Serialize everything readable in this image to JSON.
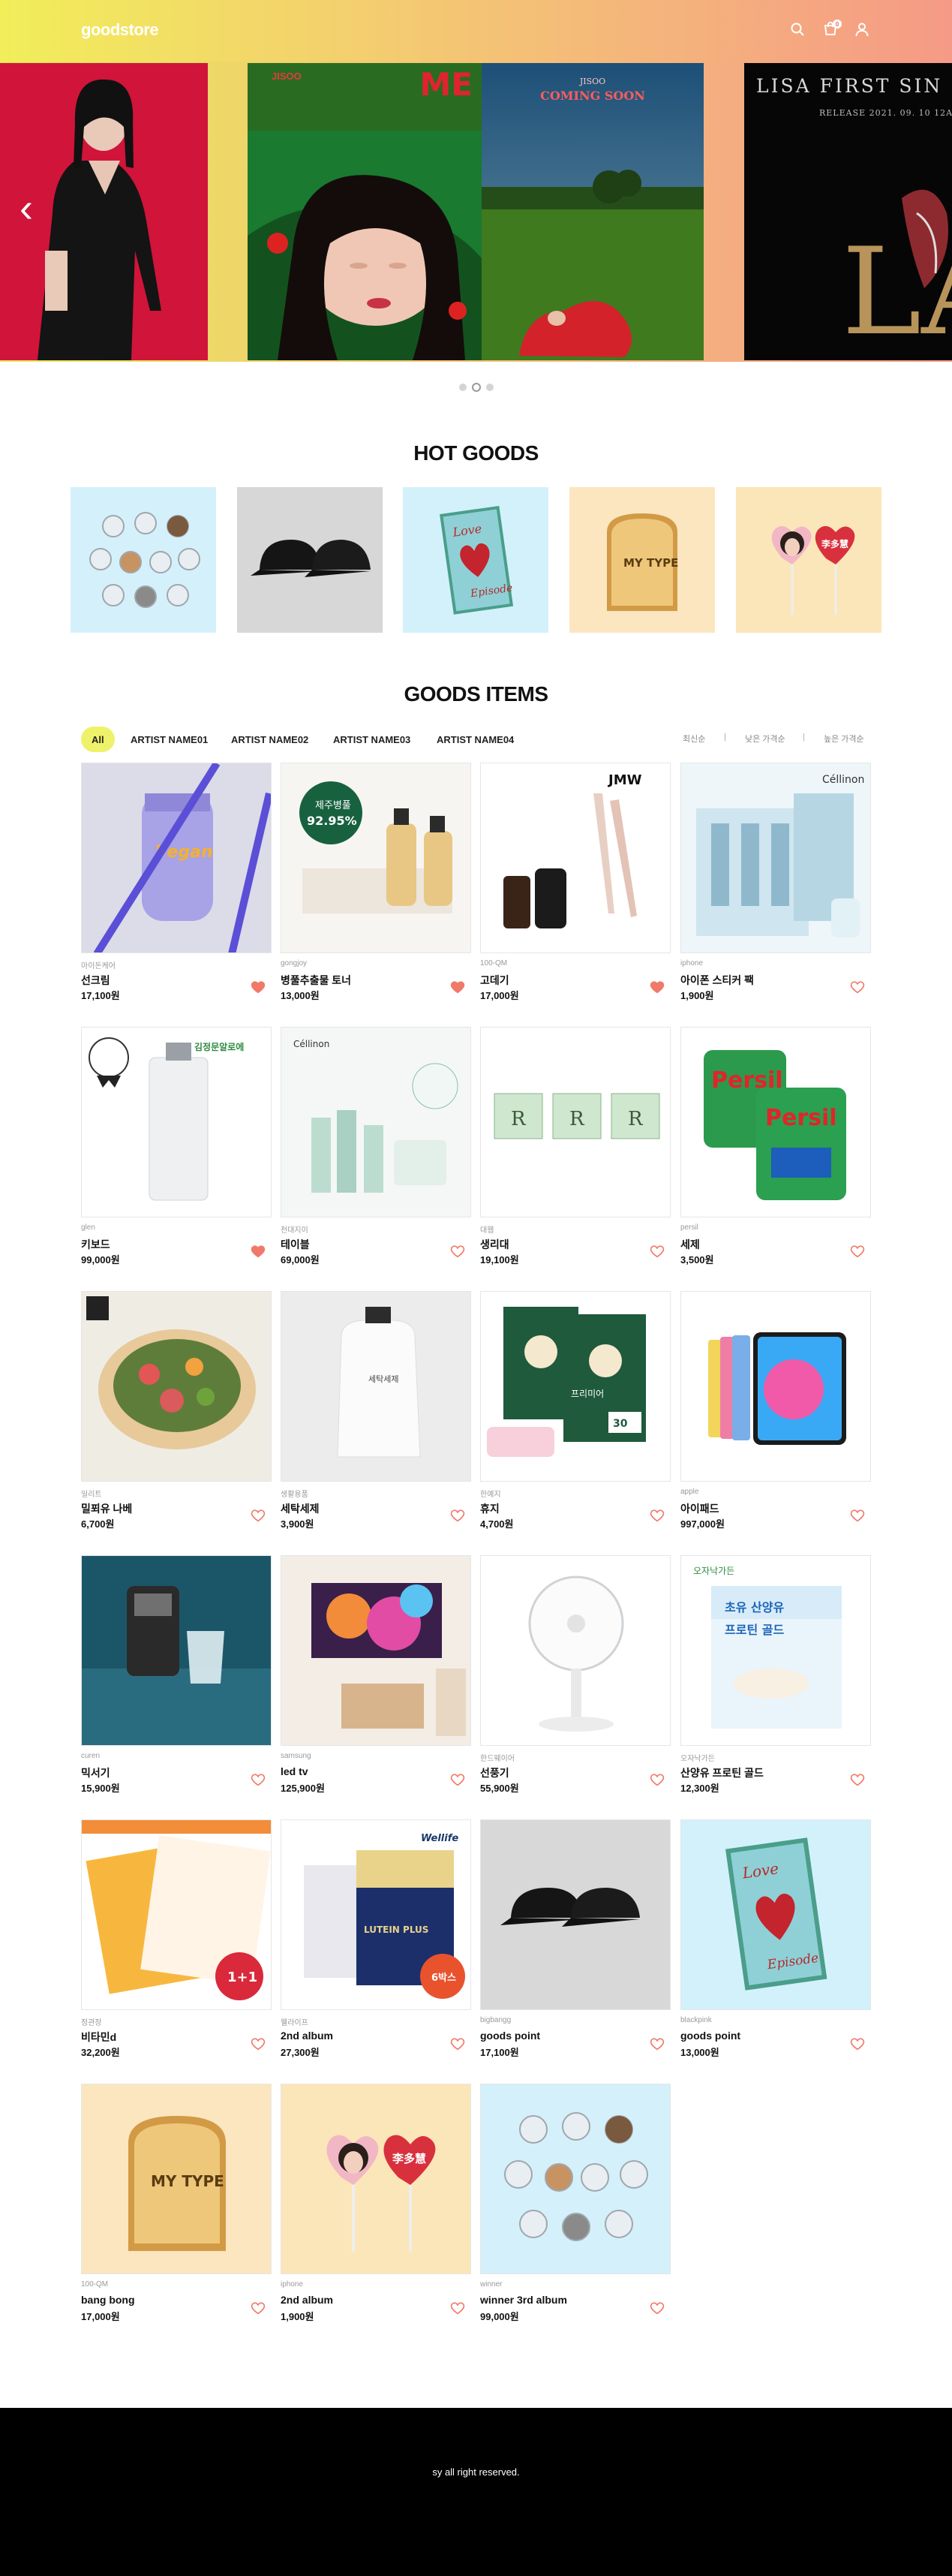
{
  "header": {
    "logo": "goodstore",
    "cart_count": "0"
  },
  "hero": {
    "slides": [
      {
        "label": ""
      },
      {
        "title": "JISOO",
        "subtitle": "ME"
      },
      {
        "title": "JISOO",
        "subtitle": "COMING SOON"
      },
      {
        "title": "LISA FIRST SIN",
        "subtitle": "RELEASE 2021. 09. 10 12A"
      }
    ],
    "active_dot": 1,
    "dot_count": 3
  },
  "hot_goods": {
    "title": "HOT GOODS"
  },
  "goods_items": {
    "title": "GOODS ITEMS",
    "filters": [
      "All",
      "ARTIST NAME01",
      "ARTIST NAME02",
      "ARTIST NAME03",
      "ARTIST NAME04"
    ],
    "sorts": [
      "최신순",
      "낮은 가격순",
      "높은 가격순"
    ],
    "products": [
      {
        "brand": "아이돈케어",
        "name": "선크림",
        "price": "17,100원",
        "liked": true,
        "img": "sunstick"
      },
      {
        "brand": "gongjoy",
        "name": "병풀추출물 토너",
        "price": "13,000원",
        "liked": true,
        "img": "toner",
        "badge": "제주병풀",
        "badge2": "92.95%"
      },
      {
        "brand": "100-QM",
        "name": "고데기",
        "price": "17,000원",
        "liked": true,
        "img": "iron",
        "tag": "JMW"
      },
      {
        "brand": "iphone",
        "name": "아이폰 스티커 팩",
        "price": "1,900원",
        "liked": false,
        "img": "cellinon",
        "tag": "Céllinon"
      },
      {
        "brand": "glen",
        "name": "키보드",
        "price": "99,000원",
        "liked": true,
        "img": "bottle"
      },
      {
        "brand": "천대지이",
        "name": "테이블",
        "price": "69,000원",
        "liked": false,
        "img": "cellinon2",
        "tag": "Céllinon"
      },
      {
        "brand": "대웹",
        "name": "생리대",
        "price": "19,100원",
        "liked": false,
        "img": "pads"
      },
      {
        "brand": "persil",
        "name": "세제",
        "price": "3,500원",
        "liked": false,
        "img": "persil",
        "tag": "Persil"
      },
      {
        "brand": "일리트",
        "name": "밀푀유 나베",
        "price": "6,700원",
        "liked": false,
        "img": "nabe"
      },
      {
        "brand": "생활용품",
        "name": "세탁세제",
        "price": "3,900원",
        "liked": false,
        "img": "detergent"
      },
      {
        "brand": "한예지",
        "name": "휴지",
        "price": "4,700원",
        "liked": false,
        "img": "tissue"
      },
      {
        "brand": "apple",
        "name": "아이패드",
        "price": "997,000원",
        "liked": false,
        "img": "ipad"
      },
      {
        "brand": "curen",
        "name": "믹서기",
        "price": "15,900원",
        "liked": false,
        "img": "blender"
      },
      {
        "brand": "samsung",
        "name": "led tv",
        "price": "125,900원",
        "liked": false,
        "img": "tv"
      },
      {
        "brand": "한드웨이어",
        "name": "선풍기",
        "price": "55,900원",
        "liked": false,
        "img": "fan"
      },
      {
        "brand": "오자낙가든",
        "name": "산양유 프로틴 골드",
        "price": "12,300원",
        "liked": false,
        "img": "protein",
        "tag": "초유 산양유 프로틴 골드"
      },
      {
        "brand": "정관장",
        "name": "비타민d",
        "price": "32,200원",
        "liked": false,
        "img": "vitamin",
        "tag": "1+1"
      },
      {
        "brand": "웰라이프",
        "name": "2nd album",
        "price": "27,300원",
        "liked": false,
        "img": "lutein",
        "tag": "LUTEIN PLUS"
      },
      {
        "brand": "bigbangg",
        "name": "goods point",
        "price": "17,100원",
        "liked": false,
        "img": "caps"
      },
      {
        "brand": "blackpink",
        "name": "goods point",
        "price": "13,000원",
        "liked": false,
        "img": "episode"
      },
      {
        "brand": "100-QM",
        "name": "bang bong",
        "price": "17,000원",
        "liked": false,
        "img": "mytype",
        "tag": "MY TYPE"
      },
      {
        "brand": "iphone",
        "name": "2nd album",
        "price": "1,900원",
        "liked": false,
        "img": "fans"
      },
      {
        "brand": "winner",
        "name": "winner 3rd album",
        "price": "99,000원",
        "liked": false,
        "img": "pins"
      }
    ]
  },
  "footer": {
    "text": "sy all right reserved."
  },
  "colors": {
    "accent_yellow": "#eef26a",
    "heart": "#f07a6a",
    "footer_bg": "#000000"
  },
  "icons": [
    "search-icon",
    "cart-icon",
    "user-icon",
    "chevron-left-icon",
    "heart-icon"
  ]
}
